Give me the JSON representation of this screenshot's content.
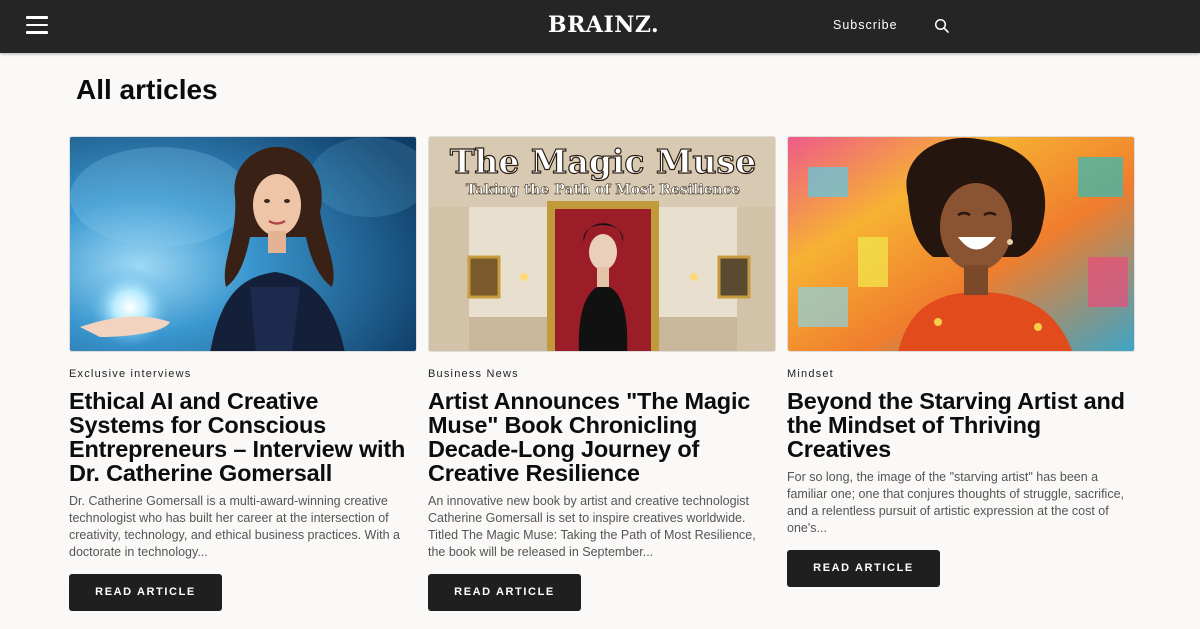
{
  "header": {
    "brand": "BRAINZ.",
    "subscribe_label": "Subscribe",
    "menu_icon": "hamburger-menu-icon",
    "search_icon": "search-icon",
    "background": "#252525"
  },
  "page_title": "All articles",
  "articles": [
    {
      "category": "Exclusive interviews",
      "title": "Ethical AI and Creative Systems for Conscious Entrepreneurs – Interview with Dr. Catherine Gomersall",
      "excerpt": "Dr. Catherine Gomersall is a multi-award-winning creative technologist who has built her career at the intersection of creativity, technology, and ethical business practices. With a doctorate in technology...",
      "button_label": "READ ARTICLE"
    },
    {
      "category": "Business News",
      "title": "Artist Announces \"The Magic Muse\" Book Chronicling Decade-Long Journey of Creative Resilience",
      "excerpt": "An innovative new book by artist and creative technologist Catherine Gomersall is set to inspire creatives worldwide. Titled The Magic Muse: Taking the Path of Most Resilience, the book will be released in September...",
      "button_label": "READ ARTICLE",
      "image_title": "The Magic Muse",
      "image_subtitle": "Taking the Path of Most Resilience"
    },
    {
      "category": "Mindset",
      "title": "Beyond the Starving Artist and the Mindset of Thriving Creatives",
      "excerpt": "For so long, the image of the \"starving artist\" has been a familiar one; one that conjures thoughts of struggle, sacrifice, and a relentless pursuit of artistic expression at the cost of one's...",
      "button_label": "READ ARTICLE"
    }
  ]
}
